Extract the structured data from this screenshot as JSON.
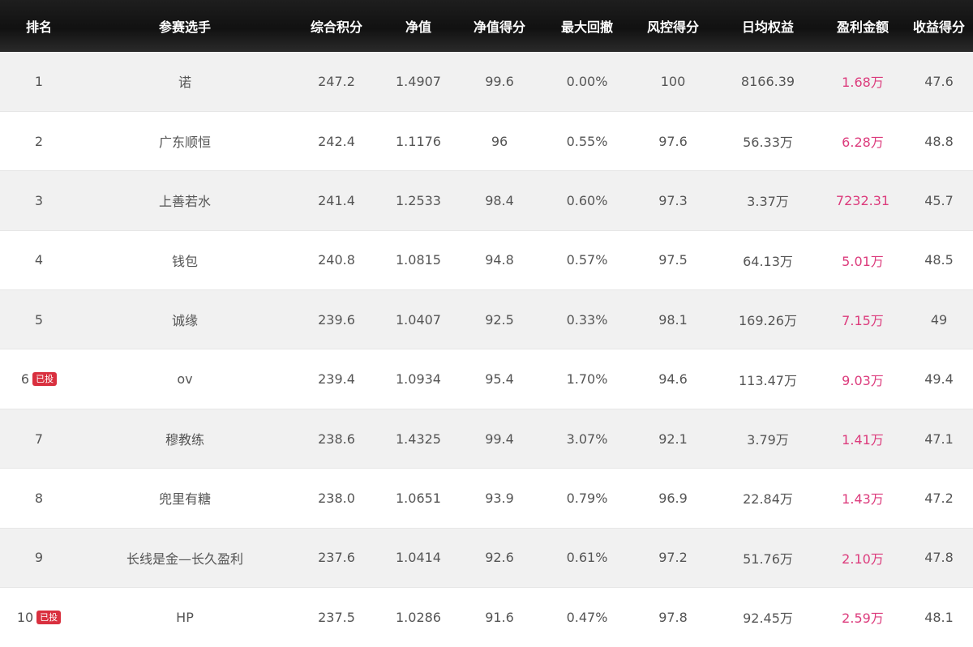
{
  "headers": {
    "rank": "排名",
    "player": "参赛选手",
    "composite": "综合积分",
    "nav": "净值",
    "nav_score": "净值得分",
    "max_drawdown": "最大回撤",
    "risk_score": "风控得分",
    "daily_equity": "日均权益",
    "profit": "盈利金额",
    "return_score": "收益得分"
  },
  "colors": {
    "header_bg": "#151515",
    "profit_text": "#dc3b7c",
    "badge_bg": "#d9303f",
    "row_alt_bg": "#f1f1f1"
  },
  "rows": [
    {
      "rank": "1",
      "badge": "",
      "player": "诺",
      "composite": "247.2",
      "nav": "1.4907",
      "nav_score": "99.6",
      "max_drawdown": "0.00%",
      "risk_score": "100",
      "daily_equity": "8166.39",
      "profit": "1.68万",
      "return_score": "47.6"
    },
    {
      "rank": "2",
      "badge": "",
      "player": "广东顺恒",
      "composite": "242.4",
      "nav": "1.1176",
      "nav_score": "96",
      "max_drawdown": "0.55%",
      "risk_score": "97.6",
      "daily_equity": "56.33万",
      "profit": "6.28万",
      "return_score": "48.8"
    },
    {
      "rank": "3",
      "badge": "",
      "player": "上善若水",
      "composite": "241.4",
      "nav": "1.2533",
      "nav_score": "98.4",
      "max_drawdown": "0.60%",
      "risk_score": "97.3",
      "daily_equity": "3.37万",
      "profit": "7232.31",
      "return_score": "45.7"
    },
    {
      "rank": "4",
      "badge": "",
      "player": "钱包",
      "composite": "240.8",
      "nav": "1.0815",
      "nav_score": "94.8",
      "max_drawdown": "0.57%",
      "risk_score": "97.5",
      "daily_equity": "64.13万",
      "profit": "5.01万",
      "return_score": "48.5"
    },
    {
      "rank": "5",
      "badge": "",
      "player": "诚缘",
      "composite": "239.6",
      "nav": "1.0407",
      "nav_score": "92.5",
      "max_drawdown": "0.33%",
      "risk_score": "98.1",
      "daily_equity": "169.26万",
      "profit": "7.15万",
      "return_score": "49"
    },
    {
      "rank": "6",
      "badge": "已投",
      "player": "ov",
      "composite": "239.4",
      "nav": "1.0934",
      "nav_score": "95.4",
      "max_drawdown": "1.70%",
      "risk_score": "94.6",
      "daily_equity": "113.47万",
      "profit": "9.03万",
      "return_score": "49.4"
    },
    {
      "rank": "7",
      "badge": "",
      "player": "穆教练",
      "composite": "238.6",
      "nav": "1.4325",
      "nav_score": "99.4",
      "max_drawdown": "3.07%",
      "risk_score": "92.1",
      "daily_equity": "3.79万",
      "profit": "1.41万",
      "return_score": "47.1"
    },
    {
      "rank": "8",
      "badge": "",
      "player": "兜里有糖",
      "composite": "238.0",
      "nav": "1.0651",
      "nav_score": "93.9",
      "max_drawdown": "0.79%",
      "risk_score": "96.9",
      "daily_equity": "22.84万",
      "profit": "1.43万",
      "return_score": "47.2"
    },
    {
      "rank": "9",
      "badge": "",
      "player": "长线是金—长久盈利",
      "composite": "237.6",
      "nav": "1.0414",
      "nav_score": "92.6",
      "max_drawdown": "0.61%",
      "risk_score": "97.2",
      "daily_equity": "51.76万",
      "profit": "2.10万",
      "return_score": "47.8"
    },
    {
      "rank": "10",
      "badge": "已投",
      "player": "HP",
      "composite": "237.5",
      "nav": "1.0286",
      "nav_score": "91.6",
      "max_drawdown": "0.47%",
      "risk_score": "97.8",
      "daily_equity": "92.45万",
      "profit": "2.59万",
      "return_score": "48.1"
    }
  ]
}
